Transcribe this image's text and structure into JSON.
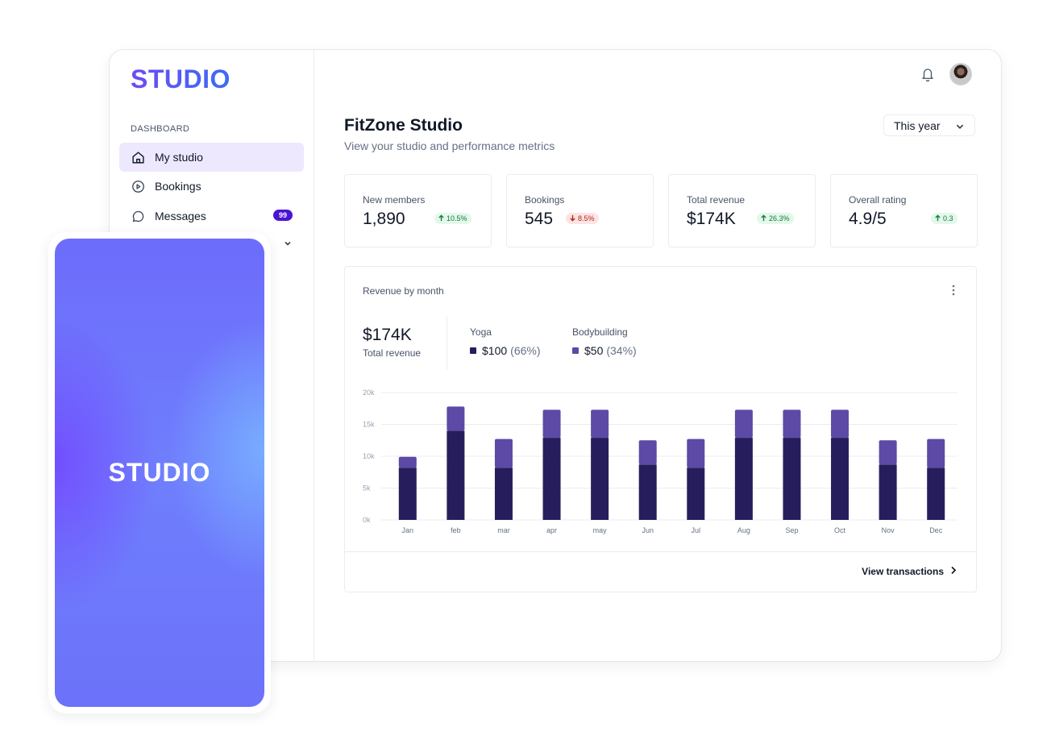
{
  "app": {
    "logo": "STUDIO"
  },
  "sidebar": {
    "section": "DASHBOARD",
    "items": [
      {
        "label": "My studio",
        "icon": "home-icon"
      },
      {
        "label": "Bookings",
        "icon": "play-circle-icon"
      },
      {
        "label": "Messages",
        "icon": "chat-bubble-icon",
        "badge": "99"
      }
    ]
  },
  "header": {
    "title": "FitZone Studio",
    "subtitle": "View your studio and performance metrics",
    "period": "This year"
  },
  "stats": [
    {
      "label": "New members",
      "value": "1,890",
      "change": "10.5%",
      "direction": "up"
    },
    {
      "label": "Bookings",
      "value": "545",
      "change": "8.5%",
      "direction": "down"
    },
    {
      "label": "Total revenue",
      "value": "$174K",
      "change": "26.3%",
      "direction": "up"
    },
    {
      "label": "Overall rating",
      "value": "4.9/5",
      "change": "0.3",
      "direction": "up"
    }
  ],
  "revenue": {
    "title": "Revenue by month",
    "total_value": "$174K",
    "total_label": "Total revenue",
    "legend": [
      {
        "name": "Yoga",
        "value": "$100",
        "pct": "(66%)",
        "color": "#261e5c"
      },
      {
        "name": "Bodybuilding",
        "value": "$50",
        "pct": "(34%)",
        "color": "#5c4aa6"
      }
    ],
    "footer_link": "View transactions"
  },
  "chart_data": {
    "type": "bar",
    "stacked": true,
    "categories": [
      "Jan",
      "feb",
      "mar",
      "apr",
      "may",
      "Jun",
      "Jul",
      "Aug",
      "Sep",
      "Oct",
      "Nov",
      "Dec"
    ],
    "series": [
      {
        "name": "Yoga",
        "color": "#261e5c",
        "values": [
          8200,
          14000,
          8200,
          12900,
          12900,
          8700,
          8200,
          12900,
          12900,
          12900,
          8700,
          8200
        ]
      },
      {
        "name": "Bodybuilding",
        "color": "#5c4aa6",
        "values": [
          1700,
          3800,
          4500,
          4400,
          4400,
          3800,
          4500,
          4400,
          4400,
          4400,
          3800,
          4500
        ]
      }
    ],
    "ylim": [
      0,
      20000
    ],
    "yticks": [
      0,
      5000,
      10000,
      15000,
      20000
    ],
    "ytick_labels": [
      "0k",
      "5k",
      "10k",
      "15k",
      "20k"
    ],
    "grid": true
  },
  "phone": {
    "logo": "STUDIO"
  }
}
